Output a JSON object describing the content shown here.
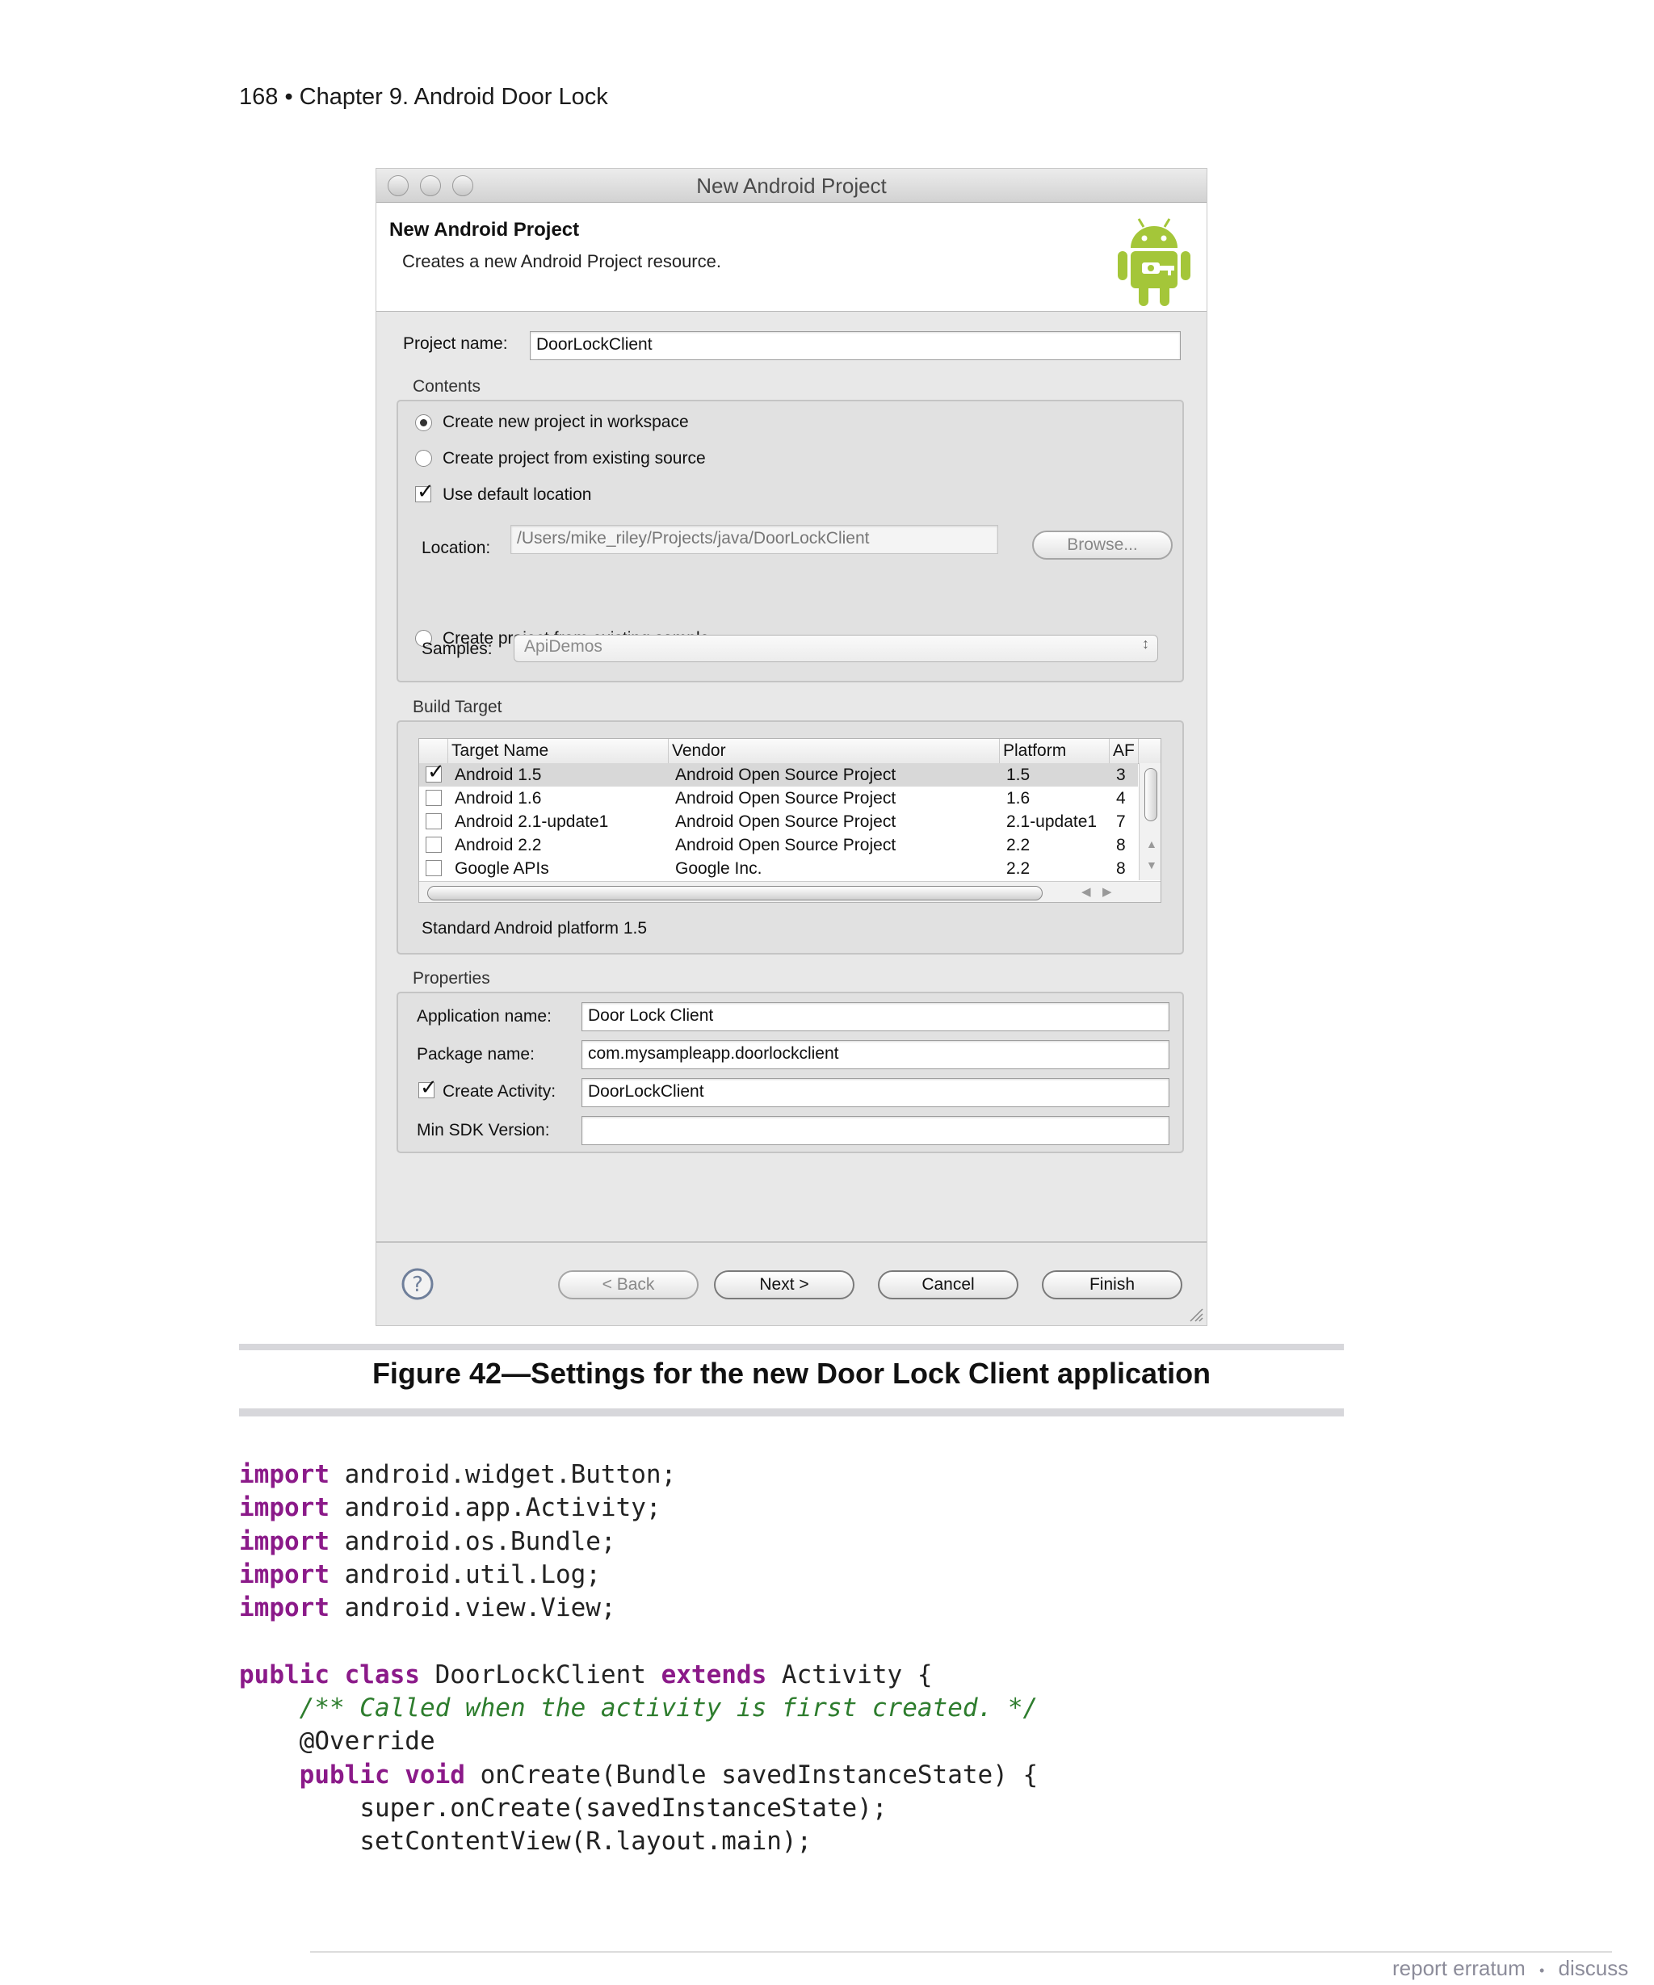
{
  "page_header": "168 • Chapter 9. Android Door Lock",
  "dialog": {
    "window_title": "New Android Project",
    "banner_title": "New Android Project",
    "banner_subtitle": "Creates a new Android Project resource.",
    "project_name_label": "Project name:",
    "project_name_value": "DoorLockClient",
    "contents": {
      "title": "Contents",
      "opt_new": "Create new project in workspace",
      "opt_existing": "Create project from existing source",
      "use_default": "Use default location",
      "location_label": "Location:",
      "location_value": "/Users/mike_riley/Projects/java/DoorLockClient",
      "browse": "Browse...",
      "opt_sample": "Create project from existing sample",
      "samples_label": "Samples:",
      "samples_value": "ApiDemos"
    },
    "build_target": {
      "title": "Build Target",
      "columns": [
        "Target Name",
        "Vendor",
        "Platform",
        "AF"
      ],
      "rows": [
        {
          "name": "Android 1.5",
          "vendor": "Android Open Source Project",
          "platform": "1.5",
          "api": "3",
          "checked": true
        },
        {
          "name": "Android 1.6",
          "vendor": "Android Open Source Project",
          "platform": "1.6",
          "api": "4",
          "checked": false
        },
        {
          "name": "Android 2.1-update1",
          "vendor": "Android Open Source Project",
          "platform": "2.1-update1",
          "api": "7",
          "checked": false
        },
        {
          "name": "Android 2.2",
          "vendor": "Android Open Source Project",
          "platform": "2.2",
          "api": "8",
          "checked": false
        },
        {
          "name": "Google APIs",
          "vendor": "Google Inc.",
          "platform": "2.2",
          "api": "8",
          "checked": false
        }
      ],
      "description": "Standard Android platform 1.5"
    },
    "properties": {
      "title": "Properties",
      "app_name_label": "Application name:",
      "app_name_value": "Door Lock Client",
      "package_label": "Package name:",
      "package_value": "com.mysampleapp.doorlockclient",
      "create_activity_label": "Create Activity:",
      "create_activity_value": "DoorLockClient",
      "min_sdk_label": "Min SDK Version:",
      "min_sdk_value": ""
    },
    "buttons": {
      "back": "< Back",
      "next": "Next >",
      "cancel": "Cancel",
      "finish": "Finish"
    },
    "icons": [
      "help-icon",
      "android-logo-icon",
      "resize-grip-icon"
    ]
  },
  "caption": "Figure 42—Settings for the new Door Lock Client application",
  "code": [
    {
      "kw": "import",
      "text": " android.widget.Button;"
    },
    {
      "kw": "import",
      "text": " android.app.Activity;"
    },
    {
      "kw": "import",
      "text": " android.os.Bundle;"
    },
    {
      "kw": "import",
      "text": " android.util.Log;"
    },
    {
      "kw": "import",
      "text": " android.view.View;"
    }
  ],
  "code_class": {
    "kw1": "public class",
    "name": " DoorLockClient ",
    "kw2": "extends",
    "rest": " Activity {",
    "comment": "/** Called when the activity is first created. */",
    "annotation": "@Override",
    "method_kw": "public void",
    "method_rest": " onCreate(Bundle savedInstanceState) {",
    "line1": "super.onCreate(savedInstanceState);",
    "line2": "setContentView(R.layout.main);"
  },
  "footer": {
    "report": "report erratum",
    "sep": "•",
    "discuss": "discuss"
  },
  "colors": {
    "keyword": "#8b1a89",
    "comment": "#2e7d2e",
    "android_green": "#a4c639",
    "footer_text": "#8c8c9a"
  }
}
